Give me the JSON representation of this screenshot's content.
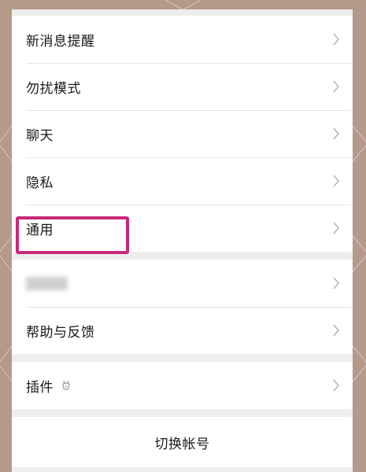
{
  "settings": {
    "items": [
      {
        "label": "新消息提醒"
      },
      {
        "label": "勿扰模式"
      },
      {
        "label": "聊天"
      },
      {
        "label": "隐私"
      },
      {
        "label": "通用"
      }
    ],
    "items2": [
      {
        "label": "帮助与反馈"
      }
    ],
    "plugins": {
      "label": "插件"
    },
    "switch_account": "切换帐号"
  },
  "colors": {
    "background": "#b49a88",
    "highlight": "#c8287a",
    "row": "#ffffff",
    "separator": "#eeeeee"
  }
}
